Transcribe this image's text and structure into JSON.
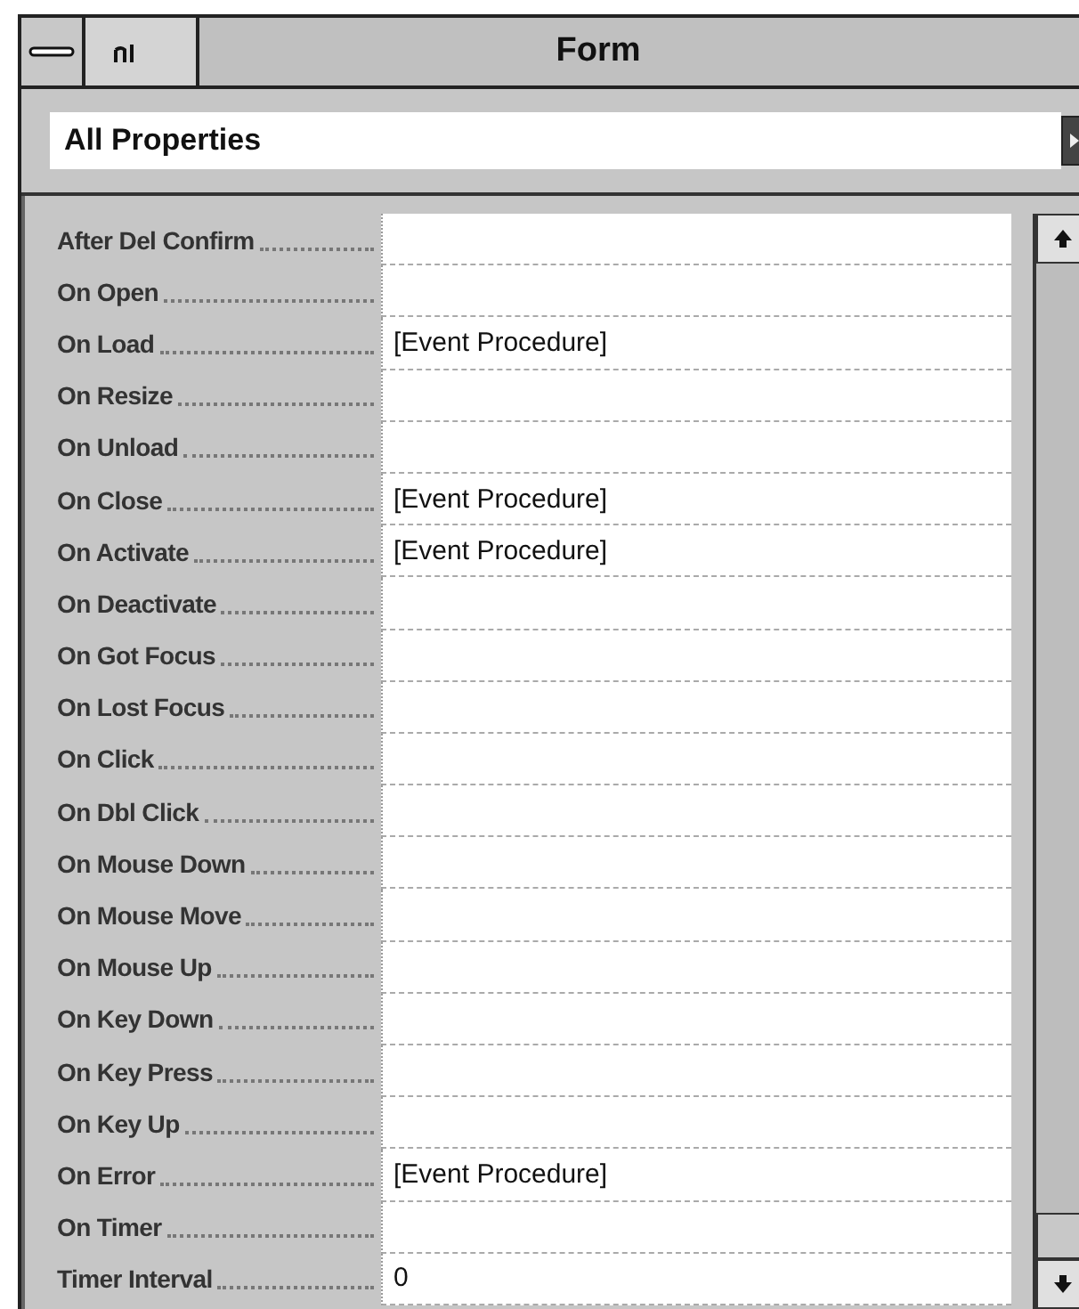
{
  "window": {
    "title": "Form"
  },
  "property_filter": {
    "value": "All Properties"
  },
  "properties": [
    {
      "name": "After Del Confirm"
    },
    {
      "name": "On Open"
    },
    {
      "name": "On Load",
      "value": "[Event Procedure]"
    },
    {
      "name": "On Resize"
    },
    {
      "name": "On Unload"
    },
    {
      "name": "On Close",
      "value": "[Event Procedure]"
    },
    {
      "name": "On Activate",
      "value": "[Event Procedure]"
    },
    {
      "name": "On Deactivate"
    },
    {
      "name": "On Got Focus"
    },
    {
      "name": "On Lost Focus"
    },
    {
      "name": "On Click"
    },
    {
      "name": "On Dbl Click"
    },
    {
      "name": "On Mouse Down"
    },
    {
      "name": "On Mouse Move"
    },
    {
      "name": "On Mouse Up"
    },
    {
      "name": "On Key Down"
    },
    {
      "name": "On Key Press"
    },
    {
      "name": "On Key Up"
    },
    {
      "name": "On Error",
      "value": "[Event Procedure]"
    },
    {
      "name": "On Timer"
    },
    {
      "name": "Timer Interval",
      "value": "0"
    }
  ]
}
